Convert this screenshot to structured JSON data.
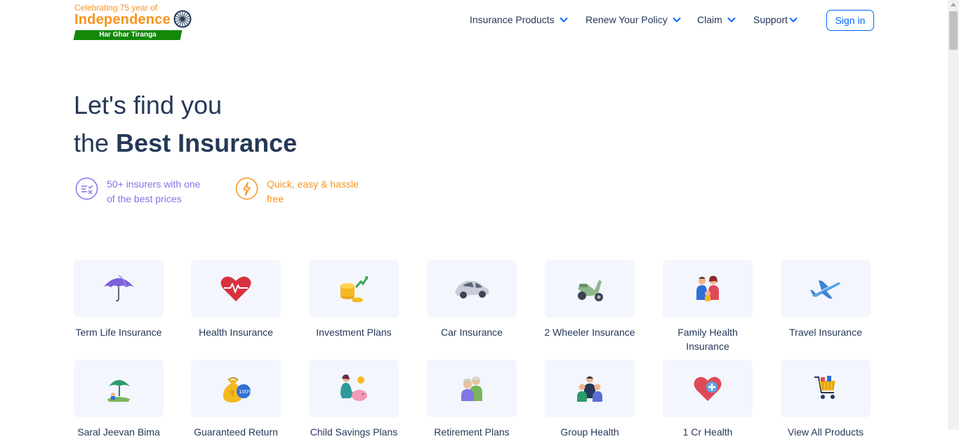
{
  "logo": {
    "line1": "Celebrating 75 year of",
    "line2": "Independence",
    "band": "Har Ghar Tiranga"
  },
  "nav": {
    "items": [
      {
        "label": "Insurance Products"
      },
      {
        "label": "Renew Your Policy"
      },
      {
        "label": "Claim"
      },
      {
        "label": "Support"
      }
    ],
    "signin": "Sign in"
  },
  "hero": {
    "line1": "Let's find you",
    "line2_prefix": "the ",
    "line2_bold": "Best Insurance"
  },
  "features": [
    {
      "text": "50+ insurers with one of the best prices",
      "color": "#8275e6",
      "icon": "compare-icon"
    },
    {
      "text": "Quick, easy & hassle free",
      "color": "#f7941d",
      "icon": "lightning-icon"
    }
  ],
  "products": [
    {
      "label": "Term Life Insurance",
      "icon": "umbrella-icon"
    },
    {
      "label": "Health Insurance",
      "icon": "heart-pulse-icon"
    },
    {
      "label": "Investment Plans",
      "icon": "coins-growth-icon"
    },
    {
      "label": "Car Insurance",
      "icon": "car-icon"
    },
    {
      "label": "2 Wheeler Insurance",
      "icon": "scooter-icon"
    },
    {
      "label": "Family Health Insurance",
      "icon": "family-icon"
    },
    {
      "label": "Travel Insurance",
      "icon": "airplane-icon"
    },
    {
      "label": "Saral Jeevan Bima",
      "icon": "plant-umbrella-icon"
    },
    {
      "label": "Guaranteed Return",
      "icon": "money-bag-icon"
    },
    {
      "label": "Child Savings Plans",
      "icon": "piggy-bank-icon"
    },
    {
      "label": "Retirement Plans",
      "icon": "elderly-couple-icon"
    },
    {
      "label": "Group Health",
      "icon": "group-icon"
    },
    {
      "label": "1 Cr Health",
      "icon": "heart-plus-icon"
    },
    {
      "label": "View All Products",
      "icon": "cart-icon"
    }
  ],
  "colors": {
    "primary": "#0065ff",
    "text": "#253858",
    "tile_bg": "#f3f6fd",
    "saffron": "#f7941d",
    "green": "#138808",
    "purple": "#8275e6"
  }
}
